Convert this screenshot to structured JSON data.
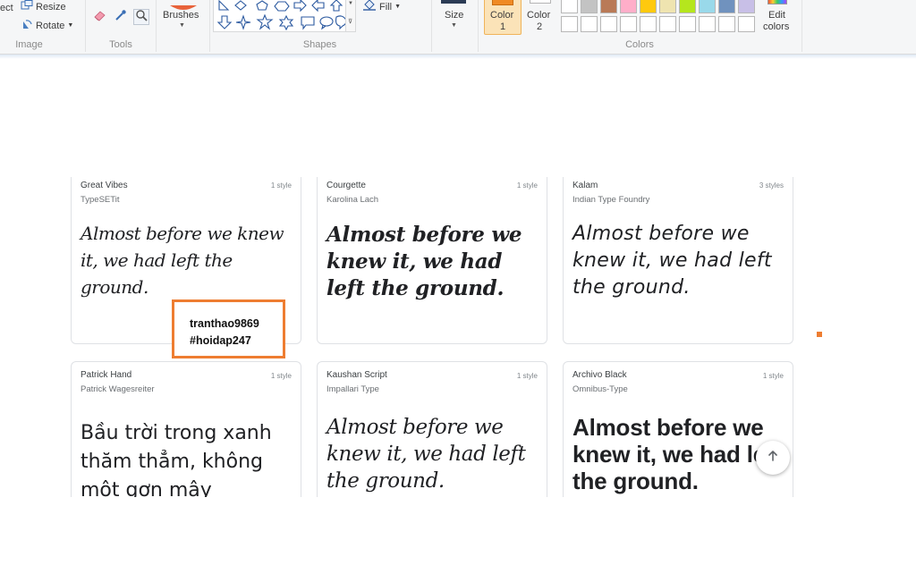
{
  "ribbon": {
    "image_group": {
      "select_label": "ect",
      "resize_label": "Resize",
      "rotate_label": "Rotate",
      "group_label": "Image"
    },
    "tools_group": {
      "group_label": "Tools"
    },
    "brushes": {
      "label": "Brushes"
    },
    "shapes_group": {
      "fill_label": "Fill",
      "group_label": "Shapes"
    },
    "size": {
      "label": "Size"
    },
    "color1": {
      "line1": "Color",
      "line2": "1",
      "color": "#f08a24"
    },
    "color2": {
      "line1": "Color",
      "line2": "2",
      "color": "#ffffff"
    },
    "colors_group": {
      "group_label": "Colors",
      "top_row": [
        "#ffffff",
        "#c3c3c3",
        "#b97a57",
        "#ffaec9",
        "#ffc90e",
        "#efe4b0",
        "#b5e61d",
        "#99d9ea",
        "#7092be",
        "#c8bfe7"
      ],
      "edit_line1": "Edit",
      "edit_line2": "colors"
    }
  },
  "cards": [
    {
      "name": "Great Vibes",
      "designer": "TypeSETit",
      "styles": "1 style",
      "sample": "Almost before we knew it, we had left the ground."
    },
    {
      "name": "Courgette",
      "designer": "Karolina Lach",
      "styles": "1 style",
      "sample": "Almost before we knew it, we had left the ground."
    },
    {
      "name": "Kalam",
      "designer": "Indian Type Foundry",
      "styles": "3 styles",
      "sample": "Almost before we knew it, we had left the ground."
    },
    {
      "name": "Patrick Hand",
      "designer": "Patrick Wagesreiter",
      "styles": "1 style",
      "sample": "Bầu trời trong xanh thăm thẳm, không một gợn mây"
    },
    {
      "name": "Kaushan Script",
      "designer": "Impallari Type",
      "styles": "1 style",
      "sample": "Almost before we knew it, we had left the ground."
    },
    {
      "name": "Archivo Black",
      "designer": "Omnibus-Type",
      "styles": "1 style",
      "sample": "Almost before we knew it, we had left the ground."
    }
  ],
  "watermark": {
    "line1": "tranthao9869",
    "line2": "#hoidap247",
    "border_color": "#ee7d31"
  },
  "icons": {
    "scroll_top": "arrow-up-icon",
    "resize": "resize-icon",
    "rotate": "rotate-icon",
    "eraser": "eraser-icon",
    "picker": "color-picker-icon",
    "magnifier": "magnifier-icon",
    "fill": "fill-icon"
  }
}
